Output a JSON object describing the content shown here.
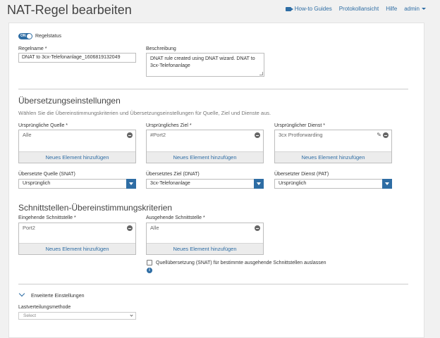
{
  "header": {
    "title": "NAT-Regel bearbeiten",
    "links": {
      "how_to": "How-to Guides",
      "log": "Protokollansicht",
      "help": "Hilfe",
      "user": "admin"
    }
  },
  "rule_status": {
    "toggle_label": "ON",
    "label": "Regelstatus"
  },
  "rule_name": {
    "label": "Regelname *",
    "value": "DNAT to 3cx-Telefonanlage_1606819132049"
  },
  "description": {
    "label": "Beschreibung",
    "value": "DNAT rule created using DNAT wizard. DNAT to 3cx-Telefonanlage"
  },
  "translation": {
    "title": "Übersetzungseinstellungen",
    "subtitle": "Wählen Sie die Übereinstimmungskriterien und Übersetzungseinstellungen für Quelle, Ziel und Dienste aus.",
    "orig_source": {
      "label": "Ursprüngliche Quelle *",
      "item": "Alle",
      "add": "Neues Element hinzufügen"
    },
    "orig_dest": {
      "label": "Ursprüngliches Ziel *",
      "item": "#Port2",
      "add": "Neues Element hinzufügen"
    },
    "orig_service": {
      "label": "Ursprünglicher Dienst *",
      "item": "3cx Protforwarding",
      "add": "Neues Element hinzufügen"
    },
    "snat": {
      "label": "Übersetzte Quelle (SNAT)",
      "value": "Ursprünglich"
    },
    "dnat": {
      "label": "Übersetztes Ziel (DNAT)",
      "value": "3cx-Telefonanlage"
    },
    "pat": {
      "label": "Übersetzter Dienst (PAT)",
      "value": "Ursprünglich"
    }
  },
  "interfaces": {
    "title": "Schnittstellen-Übereinstimmungskriterien",
    "inbound": {
      "label": "Eingehende Schnittstelle *",
      "item": "Port2",
      "add": "Neues Element hinzufügen"
    },
    "outbound": {
      "label": "Ausgehende Schnittstelle *",
      "item": "Alle",
      "add": "Neues Element hinzufügen"
    },
    "skip_snat_label": "Quellübersetzung (SNAT) für bestimmte ausgehende Schnittstellen auslassen",
    "info_glyph": "i"
  },
  "advanced": {
    "label": "Erweiterte Einstellungen",
    "lb_label": "Lastverteilungsmethode",
    "lb_placeholder": "Select"
  },
  "colors": {
    "accent": "#2e6da4"
  }
}
